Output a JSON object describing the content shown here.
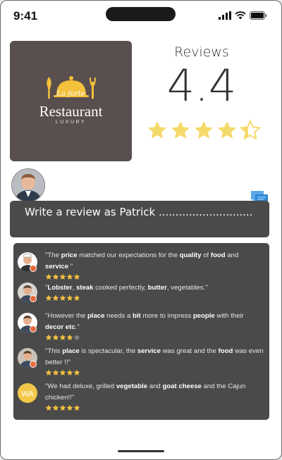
{
  "status_bar": {
    "time": "9:41"
  },
  "logo": {
    "script_text": "La forte",
    "title": "Restaurant",
    "subtitle": "LUXURY"
  },
  "summary": {
    "title": "Reviews",
    "rating": "4.4",
    "rating_value": 4.4,
    "star_color": "#f5d96b"
  },
  "composer": {
    "prompt": "Write a review as Patrick ............................"
  },
  "reviews": [
    {
      "avatar": "avatar-chef",
      "rating": 5,
      "segments": [
        [
          "\"The ",
          0
        ],
        [
          "price",
          1
        ],
        [
          " matched our expectations for the ",
          0
        ],
        [
          "quality",
          1
        ],
        [
          " of ",
          0
        ],
        [
          "food",
          1
        ],
        [
          " and ",
          0
        ],
        [
          "service",
          1
        ],
        [
          " \"",
          0
        ]
      ]
    },
    {
      "avatar": "avatar-man-1",
      "rating": 5,
      "segments": [
        [
          "\"",
          0
        ],
        [
          "Lobster",
          1
        ],
        [
          ", ",
          0
        ],
        [
          "steak",
          1
        ],
        [
          " cooked perfectly, ",
          0
        ],
        [
          "butter",
          1
        ],
        [
          ", vegetables.\"",
          0
        ]
      ]
    },
    {
      "avatar": "avatar-man-2",
      "rating": 4,
      "segments": [
        [
          "\"However the ",
          0
        ],
        [
          "place",
          1
        ],
        [
          " needs a ",
          0
        ],
        [
          "bit",
          1
        ],
        [
          " more to impress ",
          0
        ],
        [
          "people",
          1
        ],
        [
          " with their ",
          0
        ],
        [
          "decor etc",
          1
        ],
        [
          ".\"",
          0
        ]
      ]
    },
    {
      "avatar": "avatar-man-3",
      "rating": 5,
      "segments": [
        [
          "\"This ",
          0
        ],
        [
          "place",
          1
        ],
        [
          " is spectacular, the ",
          0
        ],
        [
          "service",
          1
        ],
        [
          " was great and the ",
          0
        ],
        [
          "food",
          1
        ],
        [
          " was even better !!\"",
          0
        ]
      ]
    },
    {
      "avatar": "avatar-initials",
      "initials": "WA",
      "rating": 5,
      "segments": [
        [
          "\"We had deluxe, grilled ",
          0
        ],
        [
          "vegetable",
          1
        ],
        [
          " and ",
          0
        ],
        [
          "goat cheese",
          1
        ],
        [
          " and the Cajun chicken!!\"",
          0
        ]
      ]
    }
  ]
}
